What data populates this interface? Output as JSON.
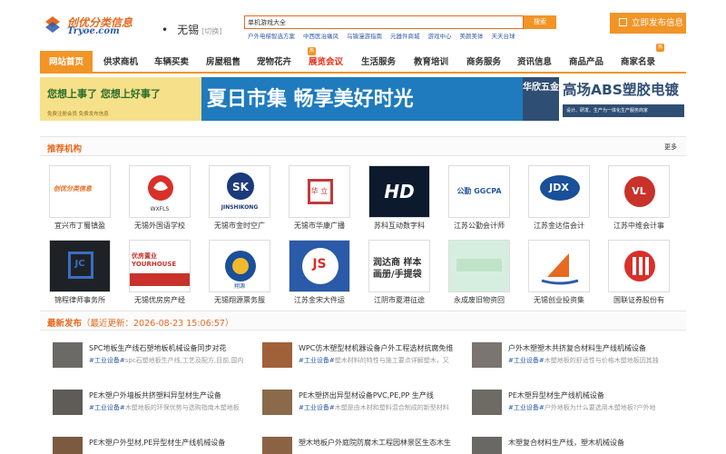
{
  "header": {
    "logo_text": "创优分类信息",
    "logo_sub": "Tryoe.com",
    "city": "无锡",
    "city_switch": "[切换]",
    "search_value": "单机游戏大全",
    "search_button": "搜索",
    "hot_words": [
      "户外电梯智选方案",
      "中西医治痛风",
      "乌镇漫游指南",
      "元器件商城",
      "游戏中心",
      "美颜美体",
      "天天台球"
    ],
    "publish_label": "立即发布信息"
  },
  "nav": {
    "items": [
      "网站首页",
      "供求商机",
      "车辆买卖",
      "房屋租售",
      "宠物花卉",
      "展览会议",
      "生活服务",
      "教育培训",
      "商务服务",
      "资讯信息",
      "商品产品",
      "商家名录"
    ],
    "hot_badge": "热"
  },
  "banner": {
    "left_slogan": "您想上事了  您想上好事了",
    "left_small": "免费注册会员  免费发布信息",
    "mid_text": "夏日市集 畅享美好时光",
    "right_logo": "华欣五金",
    "right_title": "高场ABS塑胶电镀",
    "right_sub": "设计、研发、生产为一体化生产服务商家"
  },
  "recommend": {
    "title": "推荐机构",
    "more": "更多",
    "orgs": [
      {
        "name": "宜兴市丁蜀镇盈",
        "logo": "创优分类信息"
      },
      {
        "name": "无锡外国语学校",
        "logo": "WXFLS"
      },
      {
        "name": "无锡市金时空广",
        "logo": "JINSHIKONG"
      },
      {
        "name": "无锡市华康广播",
        "logo": "华 立"
      },
      {
        "name": "苏科互动数字科",
        "logo": "HD"
      },
      {
        "name": "江苏公勤会计师",
        "logo": "公勤 GGCPA"
      },
      {
        "name": "江苏金达信会计",
        "logo": "JDX"
      },
      {
        "name": "江苏中维会计事",
        "logo": "VL"
      },
      {
        "name": "锦程律师事务所",
        "logo": "JC"
      },
      {
        "name": "无锡优房房产经",
        "logo": "优房置业 YOURHOUSE"
      },
      {
        "name": "无锡翔源票务服",
        "logo": "翔源"
      },
      {
        "name": "江苏金宋大件运",
        "logo": "JS"
      },
      {
        "name": "江阴市夏港征途",
        "logo": "润达商 样本画册/手提袋"
      },
      {
        "name": "永成废旧物资回",
        "logo": ""
      },
      {
        "name": "无锡创业投资集",
        "logo": ""
      },
      {
        "name": "国联证券股份有",
        "logo": ""
      }
    ]
  },
  "latest": {
    "title": "最新发布",
    "updated": "（最近更新：2026-08-23 15:06:57）",
    "items": [
      {
        "title": "SPC地板生产线石塑地板机械设备同步对花",
        "tag": "#工业设备#",
        "desc": "spc石塑地板生产线,工艺及配方,目前,国内"
      },
      {
        "title": "WPC仿木塑型材机器设备户外工程选材抗腐免维",
        "tag": "#工业设备#",
        "desc": "塑木材料的特性与施工要点详解塑木，又"
      },
      {
        "title": "户外木塑塑木共挤复合材料生产线机械设备",
        "tag": "#工业设备#",
        "desc": "木塑地板的舒适性与价格木塑地板因其独"
      },
      {
        "title": "PE木塑户外墙板共挤塑料异型材生产设备",
        "tag": "#工业设备#",
        "desc": "木塑地板的环保优势与选购指南木塑地板"
      },
      {
        "title": "PE木塑挤出异型材设备PVC,PE,PP 生产线",
        "tag": "#工业设备#",
        "desc": "木塑是由木材和塑料混合制成的新型材料"
      },
      {
        "title": "PE木塑异型材生产线机械设备",
        "tag": "#工业设备#",
        "desc": "户外地板为什么要选用木塑地板?户外地"
      },
      {
        "title": "PE木塑户外型材,PE异型材生产线机械设备",
        "tag": "",
        "desc": ""
      },
      {
        "title": "塑木地板户外庭院防腐木工程园林景区生态木生",
        "tag": "",
        "desc": ""
      },
      {
        "title": "木塑复合材料生产线，塑木机械设备",
        "tag": "",
        "desc": ""
      }
    ]
  }
}
